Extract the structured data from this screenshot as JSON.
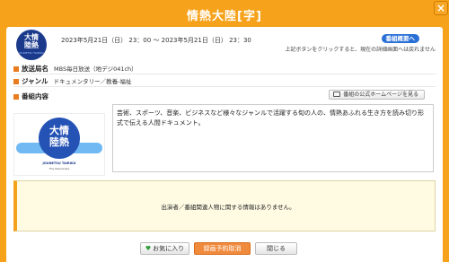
{
  "window": {
    "title": "情熱大陸[字]",
    "close_label": "×"
  },
  "program": {
    "datetime": "2023年5月21日（日） 23：00 〜 2023年5月21日（日） 23：30",
    "station_label": "放送局名",
    "station_value": "MBS毎日放送（地デジ041ch）",
    "genre_label": "ジャンル",
    "genre_value": "ドキュメンタリー／教養-福祉",
    "content_label": "番組内容",
    "description": "芸術、スポーツ、音楽、ビジネスなど様々なジャンルで活躍する旬の人の、情熱あふれる生き方を読み切り形式で伝える人間ドキュメント。"
  },
  "logo": {
    "text_line1": "大情",
    "text_line2": "陸熱",
    "small_text": "JOUNETSU TAIRIKU"
  },
  "thumbnail": {
    "logo_line1": "大情",
    "logo_line2": "陸熱",
    "caption": "JOUNETSU TAIRIKU",
    "tagline": "The Passionate"
  },
  "overview": {
    "button_label": "番組概要へ",
    "note": "上記ボタンをクリックすると、現在の詳細画面へは戻れません"
  },
  "homepage_button": "番組の公式ホームページを見る",
  "notice": "出演者／番組関連人物に関する情報はありません。",
  "actions": {
    "favorite": "お気に入り",
    "cancel_recording": "録画予約取消",
    "close": "閉じる"
  },
  "colors": {
    "frame": "#f6a21b",
    "accent_orange": "#f08a3c",
    "overview_blue": "#2a6fd6",
    "heart_green": "#2e9b3a"
  }
}
